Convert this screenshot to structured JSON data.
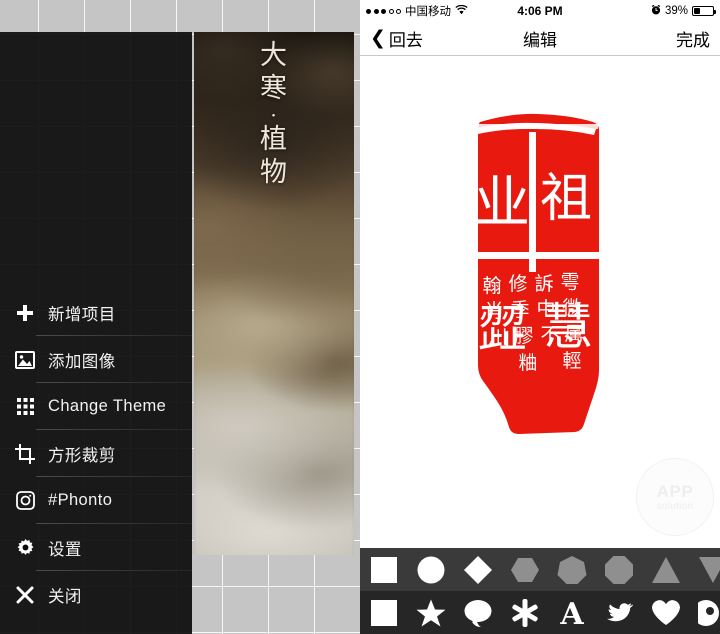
{
  "left_app": {
    "name": "Phonto",
    "overlay_text": {
      "chars": [
        "大",
        "寒",
        "·",
        "植",
        "物"
      ],
      "full": "大寒·植物"
    },
    "menu": {
      "items": [
        {
          "label": "新增项目",
          "icon": "plus-icon"
        },
        {
          "label": "添加图像",
          "icon": "image-icon"
        },
        {
          "label": "Change Theme",
          "icon": "grid-icon"
        },
        {
          "label": "方形裁剪",
          "icon": "crop-icon"
        },
        {
          "label": "#Phonto",
          "icon": "instagram-icon"
        },
        {
          "label": "设置",
          "icon": "gear-icon"
        },
        {
          "label": "关闭",
          "icon": "close-icon"
        }
      ]
    },
    "colors": {
      "menu_bg": "#0a0a0a",
      "menu_text": "#f2f2f2",
      "canvas_grid": "#c5c5c5"
    }
  },
  "right_app": {
    "statusbar": {
      "signal_dots_filled": 3,
      "signal_dots_empty": 2,
      "carrier": "中国移动",
      "wifi_icon": "wifi-icon",
      "time": "4:06 PM",
      "alarm_icon": "alarm-clock-icon",
      "battery_percent": "39%",
      "battery_fill": 0.36
    },
    "navbar": {
      "back_label": "回去",
      "back_icon": "chevron-left-icon",
      "title": "编辑",
      "done_label": "完成"
    },
    "canvas": {
      "image_name": "red-seal-stamp",
      "seal_color": "#e8190f",
      "watermark": {
        "line1": "APP",
        "line2": "solution"
      }
    },
    "shape_toolbar": {
      "rows": [
        {
          "row": "top",
          "shapes": [
            {
              "name": "square-shape",
              "color": "#ffffff"
            },
            {
              "name": "circle-shape",
              "color": "#ffffff"
            },
            {
              "name": "diamond-shape",
              "color": "#ffffff"
            },
            {
              "name": "hexagon-shape",
              "color": "#8f8f8f"
            },
            {
              "name": "heptagon-shape",
              "color": "#8f8f8f"
            },
            {
              "name": "octagon-shape",
              "color": "#8f8f8f"
            },
            {
              "name": "triangle-up-shape",
              "color": "#8f8f8f"
            },
            {
              "name": "triangle-down-shape",
              "color": "#8f8f8f"
            }
          ]
        },
        {
          "row": "bottom",
          "shapes": [
            {
              "name": "square-shape",
              "color": "#ffffff"
            },
            {
              "name": "star-shape",
              "color": "#ffffff"
            },
            {
              "name": "speech-bubble-shape",
              "color": "#ffffff"
            },
            {
              "name": "asterisk-shape",
              "color": "#ffffff"
            },
            {
              "name": "letter-a-shape",
              "color": "#ffffff"
            },
            {
              "name": "bird-shape",
              "color": "#ffffff"
            },
            {
              "name": "heart-shape",
              "color": "#ffffff"
            },
            {
              "name": "circle-partial-shape",
              "color": "#ffffff"
            }
          ]
        }
      ]
    }
  }
}
